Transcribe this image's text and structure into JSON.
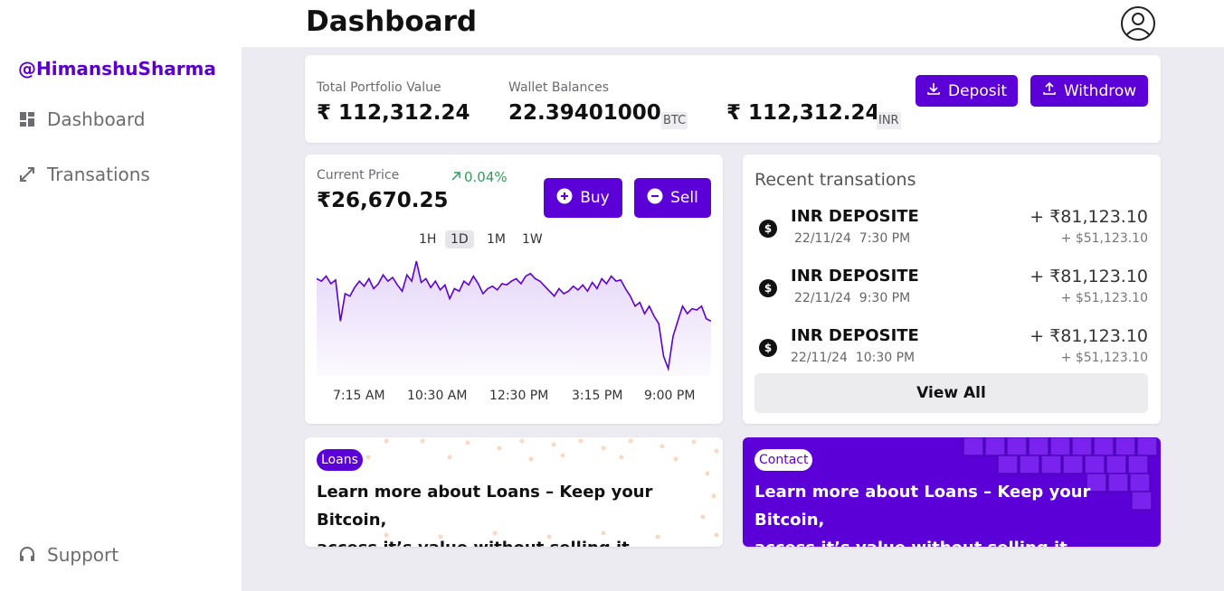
{
  "colors": {
    "brand": "#5b00d6",
    "positive": "#2e9e5a",
    "background": "#ecebf2"
  },
  "sidebar": {
    "user": "@HimanshuSharma",
    "items": [
      {
        "label": "Dashboard",
        "icon": "dashboard-icon"
      },
      {
        "label": "Transations",
        "icon": "transactions-icon"
      }
    ],
    "support": {
      "label": "Support",
      "icon": "headset-icon"
    }
  },
  "header": {
    "title": "Dashboard",
    "avatar_icon": "user-circle-icon"
  },
  "portfolio": {
    "total_label": "Total Portfolio Value",
    "total_value": "₹ 112,312.24",
    "wallet_label": "Wallet Balances",
    "btc_value": "22.39401000",
    "btc_unit": "BTC",
    "inr_value": "₹ 112,312.24",
    "inr_unit": "INR",
    "deposit_label": "Deposit",
    "withdraw_label": "Withdrow"
  },
  "price": {
    "label": "Current Price",
    "value": "₹26,670.25",
    "change": "0.04%",
    "buy_label": "Buy",
    "sell_label": "Sell",
    "ranges": [
      "1H",
      "1D",
      "1M",
      "1W"
    ],
    "active_range": "1D"
  },
  "chart_data": {
    "type": "area",
    "x_tick_labels": [
      "7:15 AM",
      "10:30 AM",
      "12:30 PM",
      "3:15 PM",
      "9:00 PM"
    ],
    "values": [
      52,
      50,
      54,
      48,
      51,
      18,
      40,
      38,
      45,
      50,
      46,
      52,
      44,
      48,
      55,
      50,
      53,
      47,
      42,
      55,
      50,
      66,
      49,
      52,
      45,
      50,
      43,
      47,
      36,
      44,
      42,
      50,
      47,
      54,
      48,
      40,
      44,
      46,
      43,
      48,
      47,
      50,
      52,
      48,
      54,
      56,
      52,
      50,
      46,
      42,
      38,
      44,
      40,
      42,
      46,
      43,
      47,
      42,
      49,
      44,
      52,
      48,
      54,
      50,
      51,
      44,
      38,
      30,
      33,
      24,
      30,
      22,
      16,
      -10,
      -20,
      6,
      18,
      30,
      24,
      28,
      27,
      30,
      20,
      18
    ],
    "color": "#5b00d6"
  },
  "transactions": {
    "title": "Recent transations",
    "items": [
      {
        "name": "INR DEPOSITE",
        "date": "22/11/24",
        "time": "7:30 PM",
        "amount": "+ ₹81,123.10",
        "sub": "+ $51,123.10"
      },
      {
        "name": "INR DEPOSITE",
        "date": "22/11/24",
        "time": "9:30 PM",
        "amount": "+ ₹81,123.10",
        "sub": "+ $51,123.10"
      },
      {
        "name": "INR DEPOSITE",
        "date": "22/11/24",
        "time": "10:30 PM",
        "amount": "+ ₹81,123.10",
        "sub": "+ $51,123.10"
      }
    ],
    "view_all": "View All"
  },
  "promos": {
    "loans": {
      "tag": "Loans",
      "line1": "Learn more about Loans – Keep your Bitcoin,",
      "line2": "access it’s value without selling it"
    },
    "contact": {
      "tag": "Contact",
      "line1": "Learn more about Loans – Keep your Bitcoin,",
      "line2": "access it’s value without selling it"
    }
  }
}
